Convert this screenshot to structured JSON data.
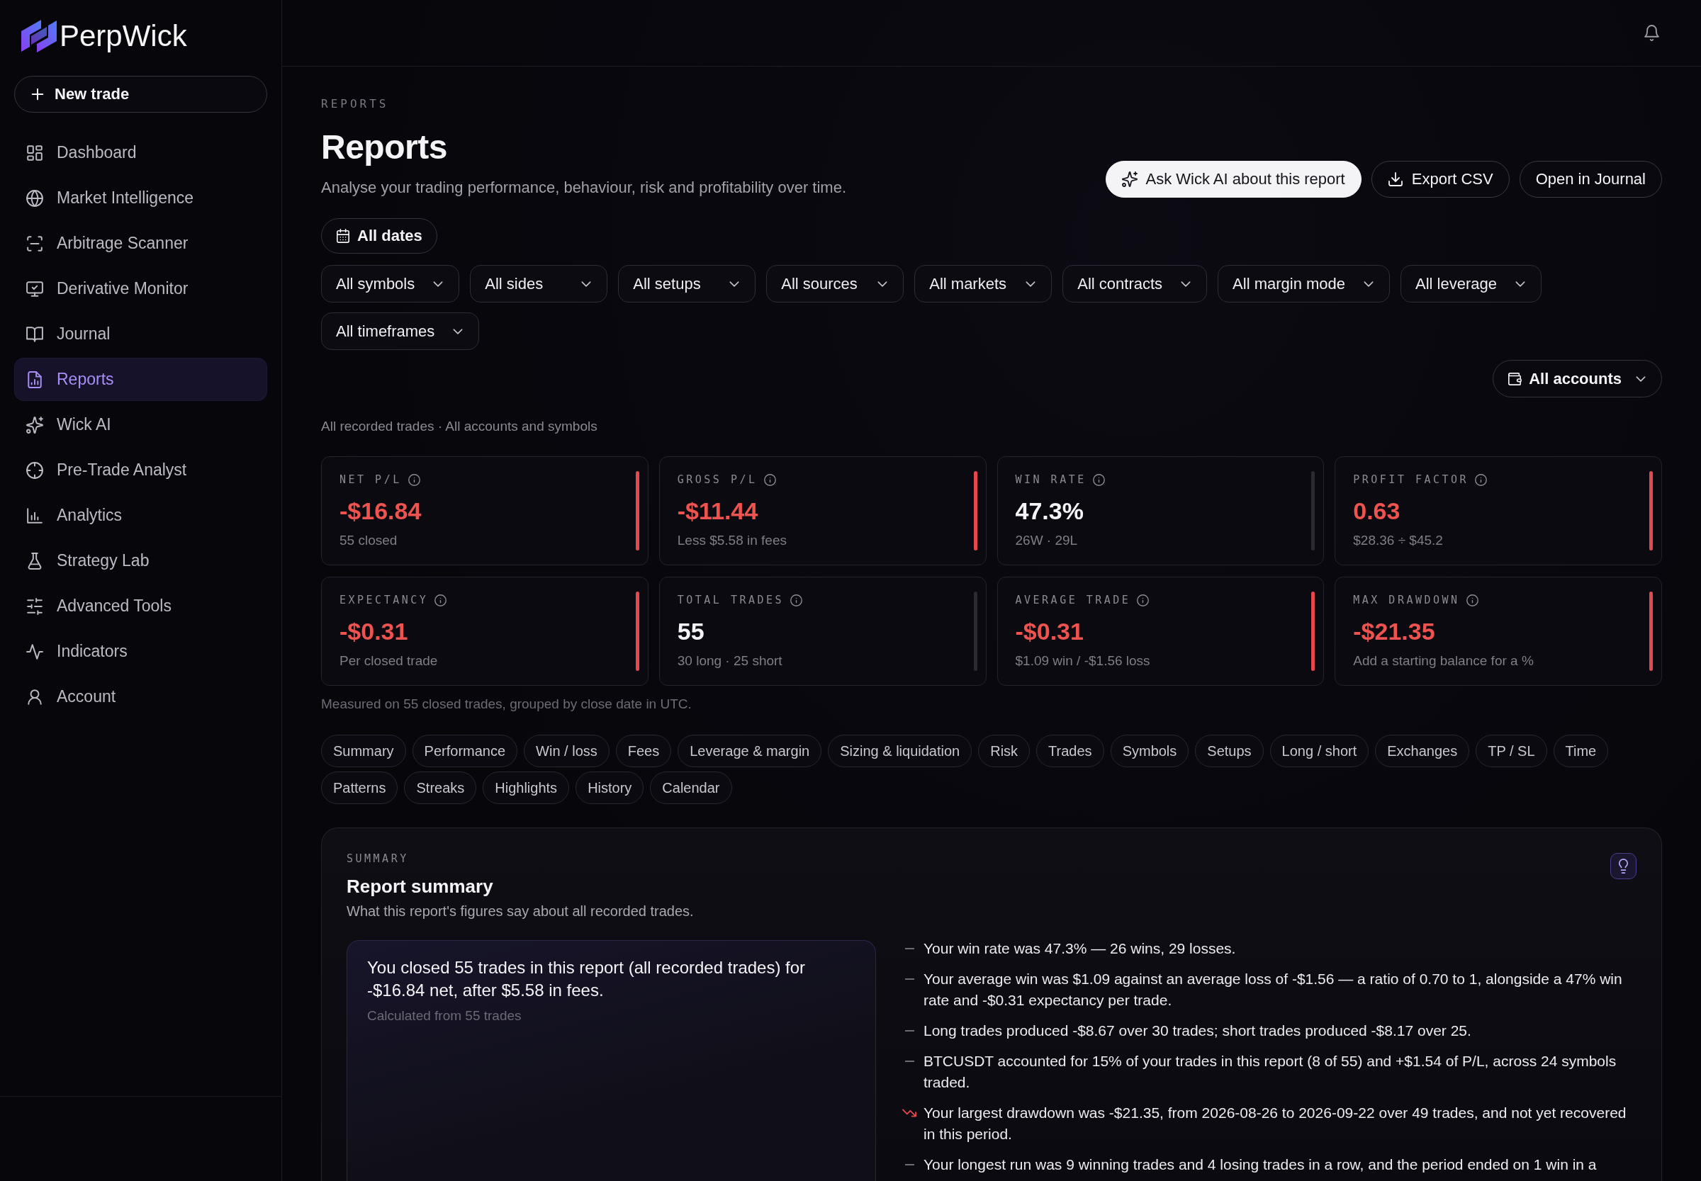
{
  "sidebar": {
    "brand": "PerpWick",
    "new_trade": "New trade",
    "items": [
      {
        "label": "Dashboard",
        "selected": false
      },
      {
        "label": "Market Intelligence",
        "selected": false
      },
      {
        "label": "Arbitrage Scanner",
        "selected": false
      },
      {
        "label": "Derivative Monitor",
        "selected": false
      },
      {
        "label": "Journal",
        "selected": false
      },
      {
        "label": "Reports",
        "selected": true
      },
      {
        "label": "Wick AI",
        "selected": false
      },
      {
        "label": "Pre-Trade Analyst",
        "selected": false
      },
      {
        "label": "Analytics",
        "selected": false
      },
      {
        "label": "Strategy Lab",
        "selected": false
      },
      {
        "label": "Advanced Tools",
        "selected": false
      },
      {
        "label": "Indicators",
        "selected": false
      },
      {
        "label": "Account",
        "selected": false
      }
    ]
  },
  "header": {
    "eyebrow": "REPORTS",
    "title": "Reports",
    "subtitle": "Analyse your trading performance, behaviour, risk and profitability over time.",
    "actions": [
      {
        "label": "Ask Wick AI about this report",
        "kind": "primary"
      },
      {
        "label": "Export CSV",
        "kind": "download"
      },
      {
        "label": "Open in Journal",
        "kind": "plain"
      }
    ]
  },
  "date_range": "All dates",
  "filters": [
    "All symbols",
    "All sides",
    "All setups",
    "All sources",
    "All markets",
    "All contracts",
    "All margin mode",
    "All leverage",
    "All timeframes"
  ],
  "account_filter": "All accounts",
  "scope_note": "All recorded trades · All accounts and symbols",
  "stats": [
    {
      "label": "NET P/L",
      "value": "-$16.84",
      "detail": "55 closed",
      "negative": true
    },
    {
      "label": "GROSS P/L",
      "value": "-$11.44",
      "detail": "Less $5.58 in fees",
      "negative": true
    },
    {
      "label": "WIN RATE",
      "value": "47.3%",
      "detail": "26W · 29L",
      "negative": false
    },
    {
      "label": "PROFIT FACTOR",
      "value": "0.63",
      "detail": "$28.36 ÷ $45.2",
      "negative": true
    },
    {
      "label": "EXPECTANCY",
      "value": "-$0.31",
      "detail": "Per closed trade",
      "negative": true
    },
    {
      "label": "TOTAL TRADES",
      "value": "55",
      "detail": "30 long · 25 short",
      "negative": false
    },
    {
      "label": "AVERAGE TRADE",
      "value": "-$0.31",
      "detail": "$1.09 win / -$1.56 loss",
      "negative": true
    },
    {
      "label": "MAX DRAWDOWN",
      "value": "-$21.35",
      "detail": "Add a starting balance for a %",
      "negative": true
    }
  ],
  "stats_note": "Measured on 55 closed trades, grouped by close date in UTC.",
  "tabs": [
    {
      "label": "Summary",
      "selected": false
    },
    {
      "label": "Performance",
      "selected": false
    },
    {
      "label": "Win / loss",
      "selected": false
    },
    {
      "label": "Fees",
      "selected": false
    },
    {
      "label": "Leverage & margin",
      "selected": false
    },
    {
      "label": "Sizing & liquidation",
      "selected": false
    },
    {
      "label": "Risk",
      "selected": false
    },
    {
      "label": "Trades",
      "selected": false
    },
    {
      "label": "Symbols",
      "selected": false
    },
    {
      "label": "Setups",
      "selected": false
    },
    {
      "label": "Long / short",
      "selected": false
    },
    {
      "label": "Exchanges",
      "selected": false
    },
    {
      "label": "TP / SL",
      "selected": false
    },
    {
      "label": "Time",
      "selected": false
    },
    {
      "label": "Patterns",
      "selected": false
    },
    {
      "label": "Streaks",
      "selected": false
    },
    {
      "label": "Highlights",
      "selected": false
    },
    {
      "label": "History",
      "selected": false
    },
    {
      "label": "Calendar",
      "selected": false
    }
  ],
  "summary": {
    "eyebrow": "SUMMARY",
    "title": "Report summary",
    "subtitle": "What this report's figures say about all recorded trades.",
    "headline": "You closed 55 trades in this report (all recorded trades) for -$16.84 net, after $5.58 in fees.",
    "headline_note": "Calculated from 55 trades",
    "points": [
      {
        "kind": "dash",
        "text": "Your win rate was 47.3% — 26 wins, 29 losses."
      },
      {
        "kind": "dash",
        "text": "Your average win was $1.09 against an average loss of -$1.56 — a ratio of 0.70 to 1, alongside a 47% win rate and -$0.31 expectancy per trade."
      },
      {
        "kind": "dash",
        "text": "Long trades produced -$8.67 over 30 trades; short trades produced -$8.17 over 25."
      },
      {
        "kind": "dash",
        "text": "BTCUSDT accounted for 15% of your trades in this report (8 of 55) and +$1.54 of P/L, across 24 symbols traded."
      },
      {
        "kind": "drawdown",
        "text": "Your largest drawdown was -$21.35, from 2026-08-26 to 2026-09-22 over 49 trades, and not yet recovered in this period."
      },
      {
        "kind": "dash",
        "text": "Your longest run was 9 winning trades and 4 losing trades in a row, and the period ended on 1 win in a"
      }
    ]
  }
}
